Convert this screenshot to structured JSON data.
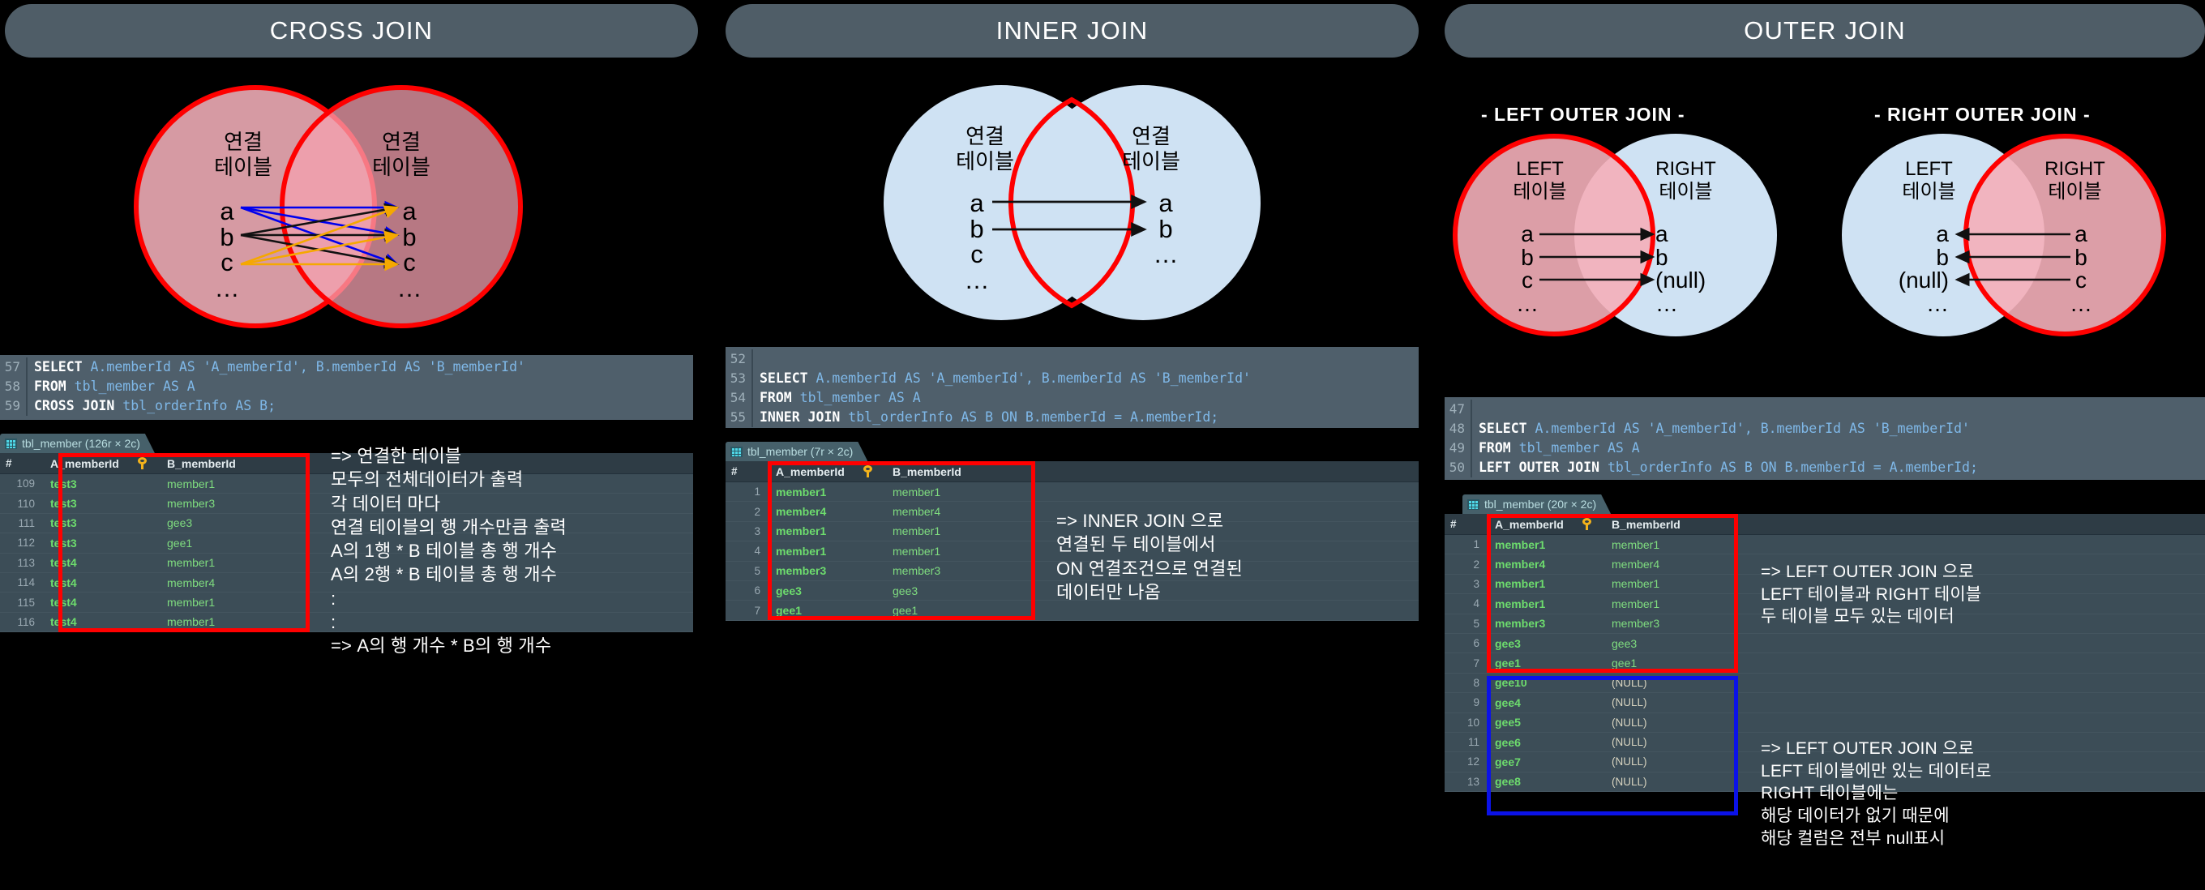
{
  "columns": {
    "cross": {
      "title": "CROSS JOIN",
      "venn": {
        "left_label": "연결\n테이블",
        "right_label": "연결\n테이블",
        "left_items": "a\nb\nc\n…",
        "right_items": "a\nb\nc\n…"
      },
      "code": {
        "lines": [
          {
            "num": "57",
            "kw1": "SELECT",
            "rest": " A.memberId AS 'A_memberId', B.memberId AS 'B_memberId'"
          },
          {
            "num": "58",
            "kw1": "FROM",
            "rest": " tbl_member AS A"
          },
          {
            "num": "59",
            "kw1": "CROSS JOIN",
            "rest": " tbl_orderInfo AS B;"
          }
        ]
      },
      "result": {
        "tab_label": "tbl_member (126r × 2c)",
        "headers": [
          "#",
          "A_memberId",
          "B_memberId"
        ],
        "rows": [
          {
            "n": "109",
            "a": "test3",
            "b": "member1"
          },
          {
            "n": "110",
            "a": "test3",
            "b": "member3"
          },
          {
            "n": "111",
            "a": "test3",
            "b": "gee3"
          },
          {
            "n": "112",
            "a": "test3",
            "b": "gee1"
          },
          {
            "n": "113",
            "a": "test4",
            "b": "member1"
          },
          {
            "n": "114",
            "a": "test4",
            "b": "member4"
          },
          {
            "n": "115",
            "a": "test4",
            "b": "member1"
          },
          {
            "n": "116",
            "a": "test4",
            "b": "member1"
          }
        ]
      },
      "note": "=> 연결한 테이블\n     모두의 전체데이터가 출력\n     각 데이터 마다\n     연결 테이블의 행 개수만큼 출력\n     A의 1행 * B 테이블 총 행 개수\n     A의 2행 * B 테이블 총 행 개수\n     :\n     :\n     => A의 행 개수 * B의 행 개수"
    },
    "inner": {
      "title": "INNER JOIN",
      "venn": {
        "left_label": "연결\n테이블",
        "right_label": "연결\n테이블",
        "left_items": "a\nb\nc\n…",
        "right_items": "a\nb\n…"
      },
      "code": {
        "lines": [
          {
            "num": "52",
            "kw1": "",
            "rest": ""
          },
          {
            "num": "53",
            "kw1": "SELECT",
            "rest": " A.memberId AS 'A_memberId', B.memberId AS 'B_memberId'"
          },
          {
            "num": "54",
            "kw1": "FROM",
            "rest": " tbl_member AS A"
          },
          {
            "num": "55",
            "kw1": "INNER JOIN",
            "rest": " tbl_orderInfo AS B ON B.memberId = A.memberId;"
          }
        ]
      },
      "result": {
        "tab_label": "tbl_member (7r × 2c)",
        "headers": [
          "#",
          "A_memberId",
          "B_memberId"
        ],
        "rows": [
          {
            "n": "1",
            "a": "member1",
            "b": "member1"
          },
          {
            "n": "2",
            "a": "member4",
            "b": "member4"
          },
          {
            "n": "3",
            "a": "member1",
            "b": "member1"
          },
          {
            "n": "4",
            "a": "member1",
            "b": "member1"
          },
          {
            "n": "5",
            "a": "member3",
            "b": "member3"
          },
          {
            "n": "6",
            "a": "gee3",
            "b": "gee3"
          },
          {
            "n": "7",
            "a": "gee1",
            "b": "gee1"
          }
        ]
      },
      "note": "=> INNER JOIN 으로\n     연결된 두 테이블에서\n     ON 연결조건으로 연결된\n     데이터만 나옴"
    },
    "outer": {
      "title": "OUTER JOIN",
      "left_sub_title": "- LEFT OUTER JOIN -",
      "right_sub_title": "- RIGHT OUTER JOIN -",
      "venn_left": {
        "left_label": "LEFT\n테이블",
        "right_label": "RIGHT\n테이블",
        "left_items": "a\nb\nc\n…",
        "right_items": "a\nb\n(null)\n…"
      },
      "venn_right": {
        "left_label": "LEFT\n테이블",
        "right_label": "RIGHT\n테이블",
        "left_items": "a\nb\n(null)\n…",
        "right_items": "a\nb\nc\n…"
      },
      "code": {
        "lines": [
          {
            "num": "47",
            "kw1": "",
            "rest": ""
          },
          {
            "num": "48",
            "kw1": "SELECT",
            "rest": " A.memberId AS 'A_memberId', B.memberId AS 'B_memberId'"
          },
          {
            "num": "49",
            "kw1": "FROM",
            "rest": " tbl_member AS A"
          },
          {
            "num": "50",
            "kw1": "LEFT OUTER JOIN",
            "rest": " tbl_orderInfo AS B ON B.memberId = A.memberId;"
          }
        ]
      },
      "result": {
        "tab_label": "tbl_member (20r × 2c)",
        "headers": [
          "#",
          "A_memberId",
          "B_memberId"
        ],
        "rows": [
          {
            "n": "1",
            "a": "member1",
            "b": "member1",
            "null": false
          },
          {
            "n": "2",
            "a": "member4",
            "b": "member4",
            "null": false
          },
          {
            "n": "3",
            "a": "member1",
            "b": "member1",
            "null": false
          },
          {
            "n": "4",
            "a": "member1",
            "b": "member1",
            "null": false
          },
          {
            "n": "5",
            "a": "member3",
            "b": "member3",
            "null": false
          },
          {
            "n": "6",
            "a": "gee3",
            "b": "gee3",
            "null": false
          },
          {
            "n": "7",
            "a": "gee1",
            "b": "gee1",
            "null": false
          },
          {
            "n": "8",
            "a": "gee10",
            "b": "(NULL)",
            "null": true
          },
          {
            "n": "9",
            "a": "gee4",
            "b": "(NULL)",
            "null": true
          },
          {
            "n": "10",
            "a": "gee5",
            "b": "(NULL)",
            "null": true
          },
          {
            "n": "11",
            "a": "gee6",
            "b": "(NULL)",
            "null": true
          },
          {
            "n": "12",
            "a": "gee7",
            "b": "(NULL)",
            "null": true
          },
          {
            "n": "13",
            "a": "gee8",
            "b": "(NULL)",
            "null": true
          }
        ]
      },
      "note_top": "=> LEFT OUTER JOIN 으로\n     LEFT 테이블과 RIGHT 테이블\n     두 테이블 모두 있는 데이터",
      "note_bottom": "=> LEFT OUTER JOIN 으로\n     LEFT 테이블에만 있는 데이터로\n     RIGHT 테이블에는\n     해당 데이터가 없기 때문에\n     해당 컬럼은 전부 null표시"
    }
  },
  "colors": {
    "pill_bg": "#4f5d67",
    "venn_red": "#ff0000",
    "venn_fill_red": "#f4afb9",
    "venn_fill_blue": "#cfe2f3",
    "code_bg": "#4f5f6b",
    "grid_bg": "#3c4d57",
    "value_green": "#6ddc6d",
    "highlight_red": "#ff0000",
    "highlight_blue": "#0b12e8"
  }
}
